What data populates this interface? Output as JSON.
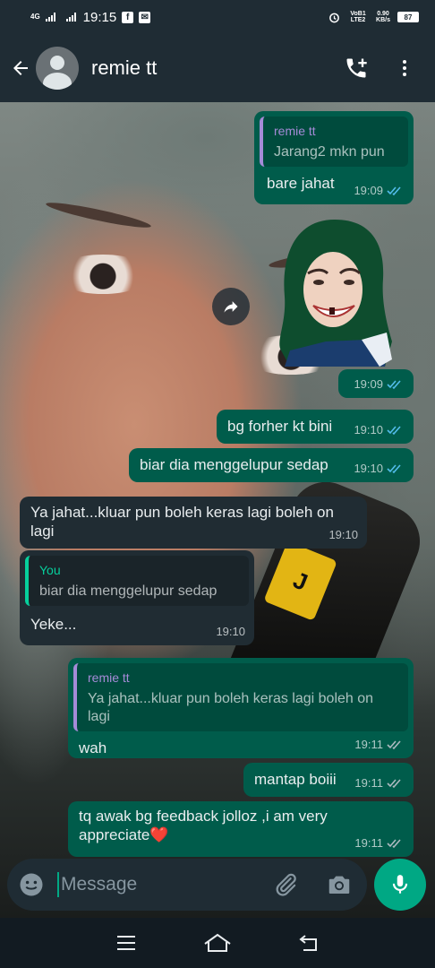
{
  "status_bar": {
    "network": "4G",
    "time": "19:15",
    "volte": "VoB1 LTE2",
    "speed_value": "0.90",
    "speed_unit": "KB/s",
    "battery": "87"
  },
  "header": {
    "contact_name": "remie tt",
    "icons": [
      "back-arrow-icon",
      "avatar",
      "add-call-icon",
      "more-vert-icon"
    ]
  },
  "messages": [
    {
      "dir": "out",
      "quote_author": "remie tt",
      "quote_text": "Jarang2 mkn pun",
      "text": "bare jahat",
      "time": "19:09",
      "ticks": "read"
    },
    {
      "dir": "out",
      "type": "sticker",
      "time": "19:09",
      "ticks": "read"
    },
    {
      "dir": "out",
      "text": "bg forher kt bini",
      "time": "19:10",
      "ticks": "read"
    },
    {
      "dir": "out",
      "text": "biar dia menggelupur sedap",
      "time": "19:10",
      "ticks": "read"
    },
    {
      "dir": "in",
      "text": "Ya jahat...kluar pun boleh keras lagi boleh on lagi",
      "time": "19:10"
    },
    {
      "dir": "in",
      "quote_author": "You",
      "quote_text": "biar dia menggelupur sedap",
      "text": "Yeke...",
      "time": "19:10"
    },
    {
      "dir": "out",
      "quote_author": "remie tt",
      "quote_text": "Ya jahat...kluar pun boleh keras lagi boleh on lagi",
      "text": "wah",
      "time": "19:11",
      "ticks": "sent"
    },
    {
      "dir": "out",
      "text": "mantap boiii",
      "time": "19:11",
      "ticks": "sent"
    },
    {
      "dir": "out",
      "text": "tq awak bg feedback jolloz ,i am very appreciate❤️",
      "time": "19:11",
      "ticks": "sent"
    }
  ],
  "wallpaper": {
    "bottle_label": "J"
  },
  "composer": {
    "placeholder": "Message",
    "icons": [
      "emoji-icon",
      "attach-icon",
      "camera-icon",
      "mic-icon"
    ]
  },
  "nav": {
    "icons": [
      "menu-icon",
      "home-icon",
      "back-icon"
    ]
  },
  "colors": {
    "outgoing_bubble": "#005c4b",
    "incoming_bubble": "#202c33",
    "accent": "#00a884",
    "read_ticks": "#53bdeb",
    "quote_author_purple": "#a58bd8",
    "quote_author_green": "#06cf9c"
  }
}
